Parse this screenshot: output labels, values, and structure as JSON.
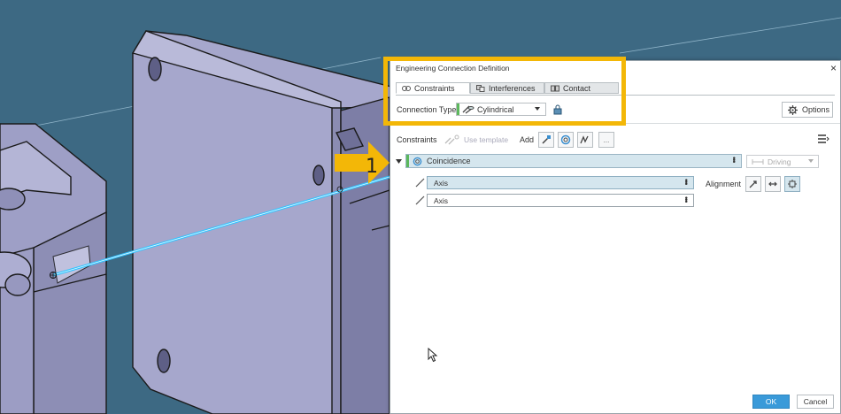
{
  "dialog": {
    "title": "Engineering Connection Definition",
    "close_glyph": "×",
    "tabs": [
      {
        "label": "Constraints",
        "icon": "constraints-icon",
        "active": true
      },
      {
        "label": "Interferences",
        "icon": "interferences-icon",
        "active": false
      },
      {
        "label": "Contact",
        "icon": "contact-icon",
        "active": false
      }
    ],
    "connection_type_label": "Connection Type",
    "connection_type_value": "Cylindrical",
    "options_label": "Options",
    "constraints_label": "Constraints",
    "use_template_label": "Use template",
    "add_label": "Add",
    "more_label": "...",
    "constraint": {
      "name": "Coincidence",
      "driving_label": "Driving"
    },
    "geometry": [
      {
        "label": "Axis",
        "selected": true
      },
      {
        "label": "Axis",
        "selected": false
      }
    ],
    "alignment_label": "Alignment",
    "ok_label": "OK",
    "cancel_label": "Cancel"
  },
  "callout": {
    "number": "1",
    "color": "#f3b707"
  },
  "colors": {
    "viewport_bg": "#3d6983",
    "part_face": "#a6a7cc",
    "axis_highlight": "#33c3ff",
    "accent": "#3a9ad9",
    "status_green": "#5cb85c"
  }
}
